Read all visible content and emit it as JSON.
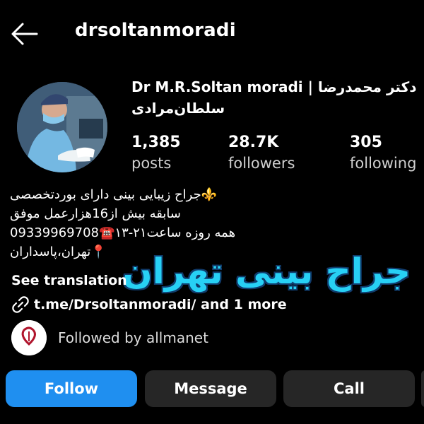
{
  "header": {
    "username": "drsoltanmoradi"
  },
  "profile": {
    "display_name_line1": "Dr M.R.Soltan moradi | دکتر محمدرضا",
    "display_name_line2": "سلطان‌مرادی",
    "stats": [
      {
        "value": "1,385",
        "label": "posts"
      },
      {
        "value": "28.7K",
        "label": "followers"
      },
      {
        "value": "305",
        "label": "following"
      }
    ]
  },
  "bio": {
    "lines": [
      "⚜️جراح زیبایی بینی دارای بوردتخصصی",
      "سابقه بیش از16هزارعمل موفق",
      "همه روزه ساعت۲۱-۱۳☎️09339969708",
      "📍تهران،پاسداران"
    ],
    "see_translation": "See translation",
    "link_text": "t.me/Drsoltanmoradi/ and 1 more",
    "overlay_text": "جراح بینی تهران"
  },
  "followed_by": {
    "text": "Followed by allmanet",
    "avatar_label": "ALLMANET"
  },
  "actions": {
    "follow": "Follow",
    "message": "Message",
    "call": "Call"
  },
  "colors": {
    "background": "#000000",
    "follow_button": "#1f8ff0",
    "secondary_button": "#262626",
    "overlay_text": "#27d0f5"
  },
  "icons": {
    "back": "back-arrow-icon",
    "link": "link-icon"
  }
}
